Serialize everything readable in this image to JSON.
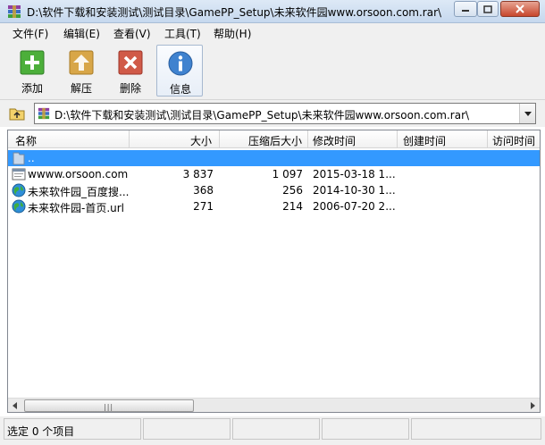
{
  "window": {
    "title": "D:\\软件下载和安装测试\\测试目录\\GamePP_Setup\\未来软件园www.orsoon.com.rar\\",
    "controls": {
      "minimize": "minimize-icon",
      "maximize": "maximize-icon",
      "close": "close-icon"
    }
  },
  "menu": [
    {
      "label": "文件(F)"
    },
    {
      "label": "编辑(E)"
    },
    {
      "label": "查看(V)"
    },
    {
      "label": "工具(T)"
    },
    {
      "label": "帮助(H)"
    }
  ],
  "toolbar": [
    {
      "label": "添加",
      "icon": "add-icon",
      "color": "#4caf3a"
    },
    {
      "label": "解压",
      "icon": "extract-icon",
      "color": "#d8a648"
    },
    {
      "label": "删除",
      "icon": "delete-icon",
      "color": "#d05a48"
    },
    {
      "label": "信息",
      "icon": "info-icon",
      "color": "#3f82cf"
    }
  ],
  "path": {
    "value": "D:\\软件下载和安装测试\\测试目录\\GamePP_Setup\\未来软件园www.orsoon.com.rar\\"
  },
  "columns": [
    "名称",
    "大小",
    "压缩后大小",
    "修改时间",
    "创建时间",
    "访问时间"
  ],
  "files": [
    {
      "name": "..",
      "size": "",
      "packed": "",
      "modified": "",
      "icon": "parent-folder-icon"
    },
    {
      "name": "wwww.orsoon.com",
      "size": "3 837",
      "packed": "1 097",
      "modified": "2015-03-18 1...",
      "icon": "file-icon"
    },
    {
      "name": "未来软件园_百度搜...",
      "size": "368",
      "packed": "256",
      "modified": "2014-10-30 1...",
      "icon": "url-globe-icon"
    },
    {
      "name": "未来软件园-首页.url",
      "size": "271",
      "packed": "214",
      "modified": "2006-07-20 2...",
      "icon": "url-globe-icon"
    }
  ],
  "status": {
    "text": "选定 0 个项目"
  },
  "colors": {
    "selection": "#3399ff",
    "title_gradient_top": "#dde9f6",
    "close_button": "#c7462c"
  }
}
